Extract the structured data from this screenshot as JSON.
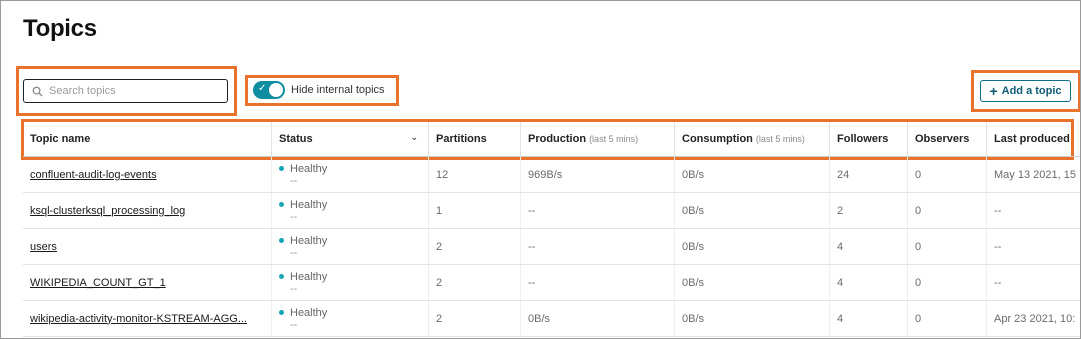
{
  "page_title": "Topics",
  "search": {
    "placeholder": "Search topics",
    "value": ""
  },
  "toggle": {
    "label": "Hide internal topics",
    "checked": true,
    "check_glyph": "✓"
  },
  "add_button": {
    "label": "Add a topic",
    "icon": "+"
  },
  "columns": [
    {
      "label": "Topic name",
      "sub": ""
    },
    {
      "label": "Status",
      "sub": "",
      "chevron": "⌄"
    },
    {
      "label": "Partitions",
      "sub": ""
    },
    {
      "label": "Production",
      "sub": "(last 5 mins)"
    },
    {
      "label": "Consumption",
      "sub": "(last 5 mins)"
    },
    {
      "label": "Followers",
      "sub": ""
    },
    {
      "label": "Observers",
      "sub": ""
    },
    {
      "label": "Last produced",
      "sub": ""
    }
  ],
  "rows": [
    {
      "name": "confluent-audit-log-events",
      "status": "Healthy",
      "status_sub": "--",
      "partitions": "12",
      "production": "969B/s",
      "consumption": "0B/s",
      "followers": "24",
      "observers": "0",
      "last_produced": "May 13 2021, 15"
    },
    {
      "name": "ksql-clusterksql_processing_log",
      "status": "Healthy",
      "status_sub": "--",
      "partitions": "1",
      "production": "--",
      "consumption": "0B/s",
      "followers": "2",
      "observers": "0",
      "last_produced": "--"
    },
    {
      "name": "users",
      "status": "Healthy",
      "status_sub": "--",
      "partitions": "2",
      "production": "--",
      "consumption": "0B/s",
      "followers": "4",
      "observers": "0",
      "last_produced": "--"
    },
    {
      "name": "WIKIPEDIA_COUNT_GT_1",
      "status": "Healthy",
      "status_sub": "--",
      "partitions": "2",
      "production": "--",
      "consumption": "0B/s",
      "followers": "4",
      "observers": "0",
      "last_produced": "--"
    },
    {
      "name": "wikipedia-activity-monitor-KSTREAM-AGG...",
      "status": "Healthy",
      "status_sub": "--",
      "partitions": "2",
      "production": "0B/s",
      "consumption": "0B/s",
      "followers": "4",
      "observers": "0",
      "last_produced": "Apr 23 2021, 10:"
    }
  ],
  "colors": {
    "accent": "#0e8ea0",
    "highlight": "#e8712b",
    "status_dot": "#18a4b8",
    "button_text": "#0f5b77"
  }
}
